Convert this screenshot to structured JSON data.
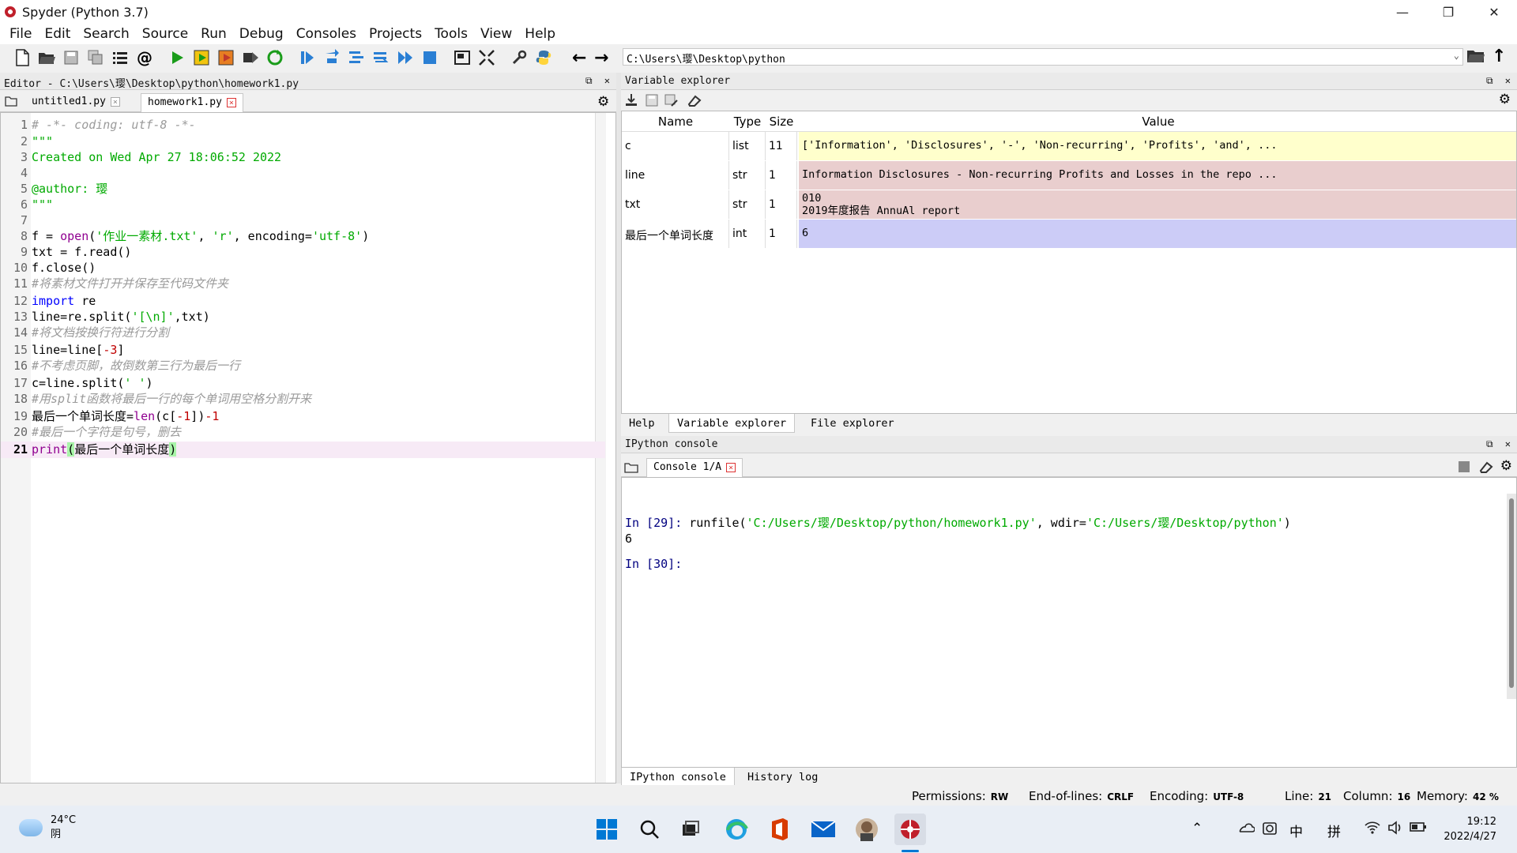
{
  "window": {
    "title": "Spyder (Python 3.7)",
    "min": "—",
    "max": "❐",
    "close": "✕"
  },
  "menu": [
    "File",
    "Edit",
    "Search",
    "Source",
    "Run",
    "Debug",
    "Consoles",
    "Projects",
    "Tools",
    "View",
    "Help"
  ],
  "toolbar": {
    "path": "C:\\Users\\璎\\Desktop\\python"
  },
  "editor": {
    "pane_title": "Editor - C:\\Users\\璎\\Desktop\\python\\homework1.py",
    "tabs": [
      {
        "label": "untitled1.py",
        "active": false
      },
      {
        "label": "homework1.py",
        "active": true
      }
    ],
    "current_line": 21
  },
  "variable_explorer": {
    "pane_title": "Variable explorer",
    "headers": {
      "name": "Name",
      "type": "Type",
      "size": "Size",
      "value": "Value"
    },
    "rows": [
      {
        "name": "c",
        "type": "list",
        "size": "11",
        "value": "['Information', 'Disclosures', '-', 'Non-recurring', 'Profits', 'and', ...",
        "color": "#ffffcc"
      },
      {
        "name": "line",
        "type": "str",
        "size": "1",
        "value": "Information Disclosures - Non-recurring Profits and Losses in the repo ...",
        "color": "#e9cece"
      },
      {
        "name": "txt",
        "type": "str",
        "size": "1",
        "value": "010\n2019年度报告 AnnuAl report",
        "color": "#e9cece"
      },
      {
        "name": "最后一个单词长度",
        "type": "int",
        "size": "1",
        "value": "6",
        "color": "#ccccf7"
      }
    ],
    "tabs": [
      "Help",
      "Variable explorer",
      "File explorer"
    ]
  },
  "console": {
    "pane_title": "IPython console",
    "tab": "Console 1/A",
    "lines": {
      "in29_prompt": "In [29]:",
      "in29_cmd_a": " runfile(",
      "in29_str1": "'C:/Users/璎/Desktop/python/homework1.py'",
      "in29_cmd_b": ", wdir=",
      "in29_str2": "'C:/Users/璎/Desktop/python'",
      "in29_cmd_c": ")",
      "out": "6",
      "in30_prompt": "In [30]:"
    },
    "tabs": [
      "IPython console",
      "History log"
    ]
  },
  "status": {
    "permissions_label": "Permissions:",
    "permissions": "RW",
    "eol_label": "End-of-lines:",
    "eol": "CRLF",
    "encoding_label": "Encoding:",
    "encoding": "UTF-8",
    "line_label": "Line:",
    "line": "21",
    "column_label": "Column:",
    "column": "16",
    "memory_label": "Memory:",
    "memory": "42 %"
  },
  "taskbar": {
    "temp": "24°C",
    "weather": "阴",
    "tray_ime1": "中",
    "tray_ime2": "拼",
    "time": "19:12",
    "date": "2022/4/27"
  },
  "colors": {
    "accent": "#0078d4",
    "string": "#00aa00",
    "keyword": "#0000ff",
    "builtin": "#900090",
    "number": "#c00000",
    "comment": "#9a9a9a"
  }
}
